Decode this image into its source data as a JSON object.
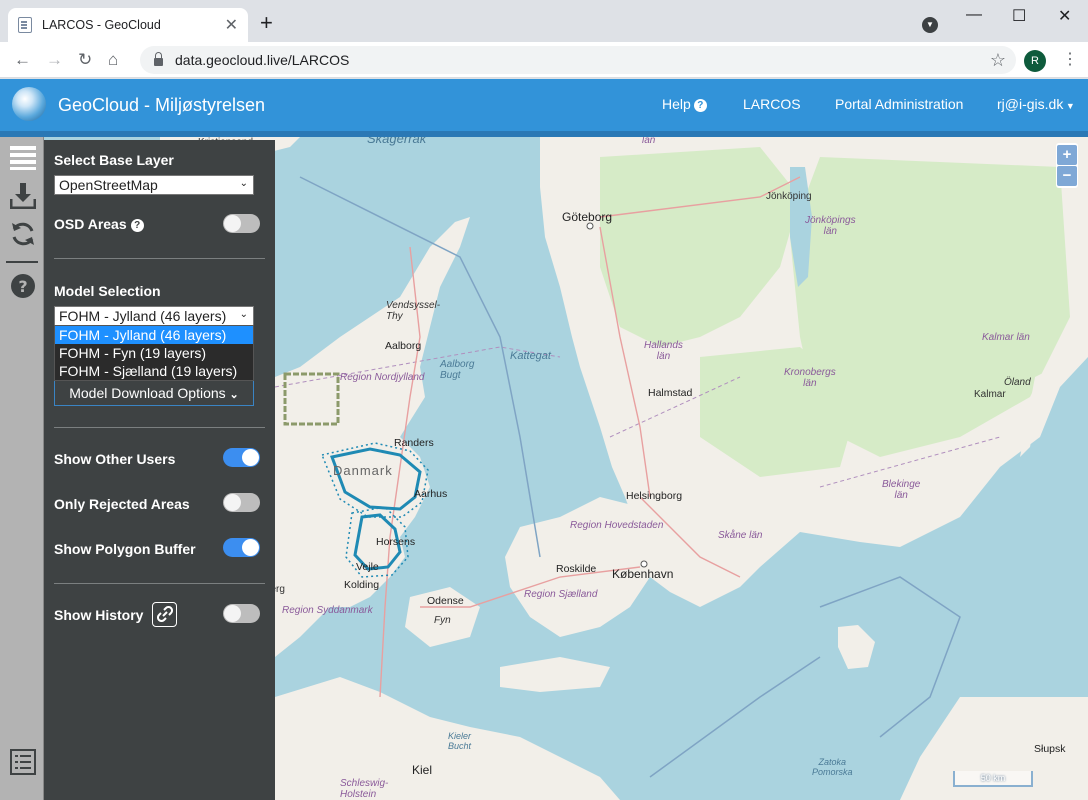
{
  "browser": {
    "tab_title": "LARCOS - GeoCloud",
    "new_tab": "+",
    "url": "data.geocloud.live/LARCOS",
    "profile_initial": "R"
  },
  "appbar": {
    "brand": "GeoCloud - Miljøstyrelsen",
    "help": "Help",
    "larcos": "LARCOS",
    "portal_admin": "Portal Administration",
    "user": "rj@i-gis.dk"
  },
  "panel": {
    "base_layer_title": "Select Base Layer",
    "base_layer_value": "OpenStreetMap",
    "osd_areas": "OSD Areas",
    "model_selection_title": "Model Selection",
    "model_value": "FOHM - Jylland (46 layers)",
    "model_options": [
      "FOHM - Jylland (46 layers)",
      "FOHM - Fyn (19 layers)",
      "FOHM - Sjælland (19 layers)"
    ],
    "download_options": "Model Download Options",
    "show_other_users": "Show Other Users",
    "only_rejected": "Only Rejected Areas",
    "show_polygon_buffer": "Show Polygon Buffer",
    "show_history": "Show History",
    "toggles": {
      "osd_areas": false,
      "show_other_users": true,
      "only_rejected": false,
      "show_polygon_buffer": true,
      "show_history": false
    }
  },
  "map": {
    "labels": {
      "skagerrak": "Skagerrak",
      "kristiansand": "Kristiansand",
      "goteborg": "Göteborg",
      "jonkoping": "Jönköping",
      "jonkopings_lan": "Jönköpings\nlän",
      "lan_top": "län",
      "vendsyssel": "Vendsyssel-\nThy",
      "aalborg": "Aalborg",
      "aalborg_bugt": "Aalborg\nBugt",
      "kattegat": "Kattegat",
      "hallands_lan": "Hallands\nlän",
      "kronobergs_lan": "Kronobergs\nlän",
      "kalmar_lan": "Kalmar län",
      "oland": "Öland",
      "kalmar": "Kalmar",
      "region_nordjylland": "Region Nordjylland",
      "halmstad": "Halmstad",
      "randers": "Randers",
      "danmark": "Danmark",
      "aarhus": "Aarhus",
      "blekinge_lan": "Blekinge\nlän",
      "helsingborg": "Helsingborg",
      "region_hovedstaden": "Region Hovedstaden",
      "skane_lan": "Skåne län",
      "horsens": "Horsens",
      "vejle": "Vejle",
      "roskilde": "Roskilde",
      "kobenhavn": "København",
      "kolding": "Kolding",
      "esbjerg": "Esbjerg",
      "odense": "Odense",
      "region_sjaelland": "Region Sjælland",
      "region_syddanmark": "Region Syddanmark",
      "fyn": "Fyn",
      "kieler_bucht": "Kieler\nBucht",
      "kiel": "Kiel",
      "schleswig": "Schleswig-\nHolstein",
      "zatoka": "Zatoka\nPomorska",
      "slupsk": "Słupsk"
    },
    "zoom_in": "+",
    "zoom_out": "−",
    "scale": "50 km"
  },
  "colors": {
    "appbar": "#3293d9",
    "panel": "#3e4243",
    "toggle_on": "#3c8ef0",
    "land": "#f2efe9",
    "forest": "#cfe6bd",
    "water": "#aad3df"
  }
}
